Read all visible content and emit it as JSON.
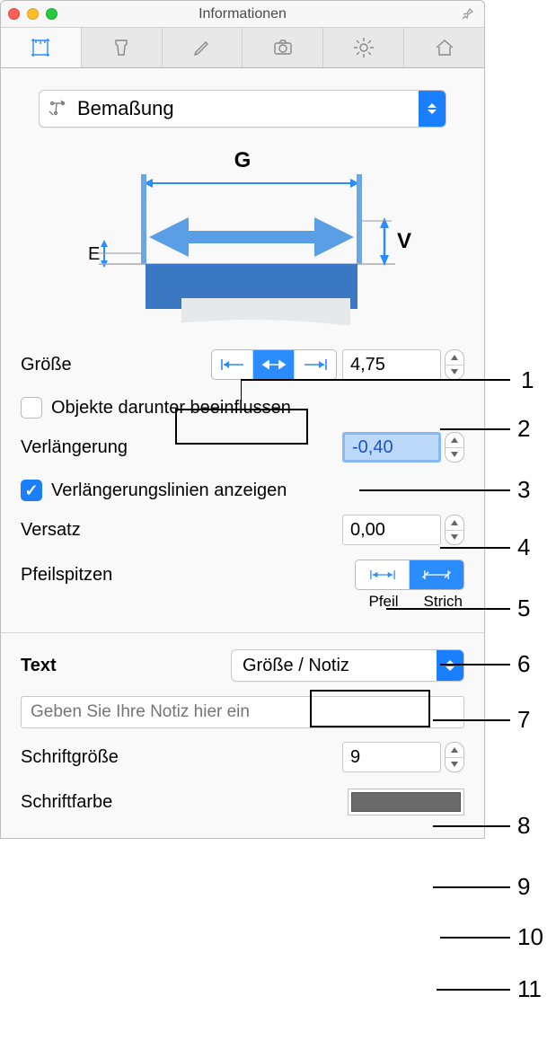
{
  "window": {
    "title": "Informationen"
  },
  "dropdown": {
    "label": "Bemaßung"
  },
  "diagram": {
    "G": "G",
    "E": "E",
    "V": "V"
  },
  "size": {
    "label": "Größe",
    "value": "4,75"
  },
  "affect": {
    "label": "Objekte darunter beeinflussen",
    "checked": false
  },
  "extension": {
    "label": "Verlängerung",
    "value": "-0,40"
  },
  "showExt": {
    "label": "Verlängerungslinien anzeigen",
    "checked": true
  },
  "offset": {
    "label": "Versatz",
    "value": "0,00"
  },
  "arrow": {
    "label": "Pfeilspitzen",
    "opt1": "Pfeil",
    "opt2": "Strich"
  },
  "text": {
    "label": "Text",
    "value": "Größe / Notiz"
  },
  "note": {
    "placeholder": "Geben Sie Ihre Notiz hier ein"
  },
  "fontSize": {
    "label": "Schriftgröße",
    "value": "9"
  },
  "fontColor": {
    "label": "Schriftfarbe",
    "hex": "#6a6a6a"
  },
  "callouts": [
    "1",
    "2",
    "3",
    "4",
    "5",
    "6",
    "7",
    "8",
    "9",
    "10",
    "11"
  ]
}
